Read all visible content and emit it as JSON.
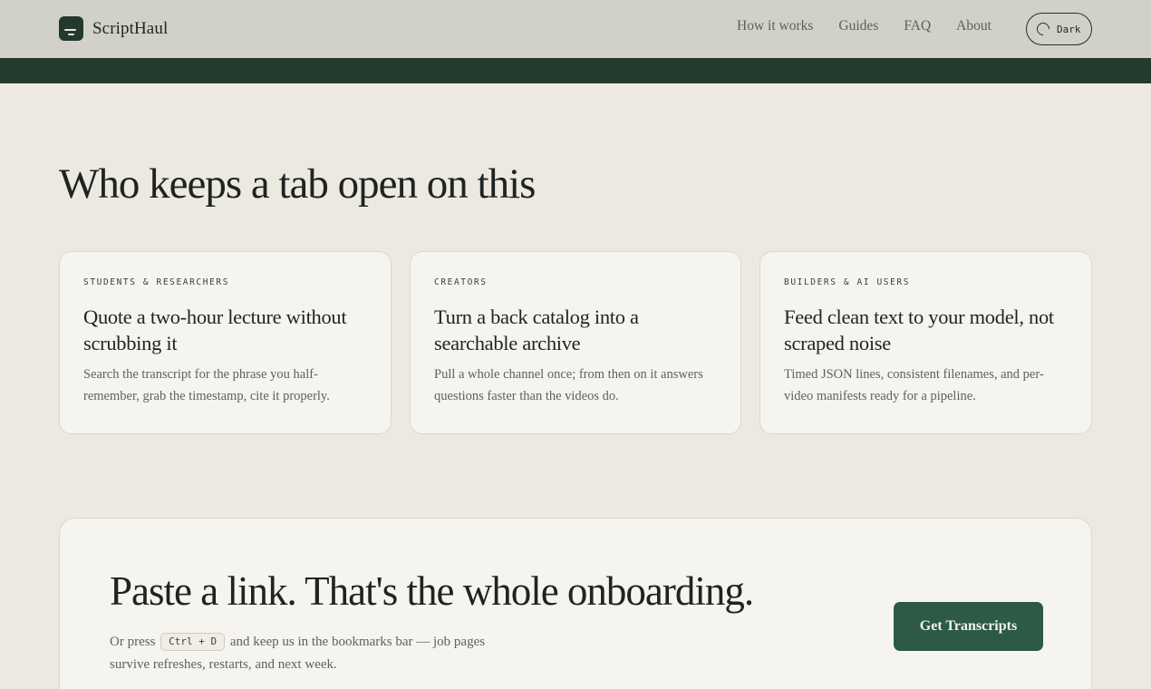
{
  "header": {
    "brand_name": "ScriptHaul",
    "nav": [
      "How it works",
      "Guides",
      "FAQ",
      "About"
    ],
    "theme_toggle_label": "Dark"
  },
  "section": {
    "title": "Who keeps a tab open on this",
    "cards": [
      {
        "eyebrow": "STUDENTS & RESEARCHERS",
        "title": "Quote a two-hour lecture without scrubbing it",
        "body": "Search the transcript for the phrase you half-remember, grab the timestamp, cite it properly."
      },
      {
        "eyebrow": "CREATORS",
        "title": "Turn a back catalog into a searchable archive",
        "body": "Pull a whole channel once; from then on it answers questions faster than the videos do."
      },
      {
        "eyebrow": "BUILDERS & AI USERS",
        "title": "Feed clean text to your model, not scraped noise",
        "body": "Timed JSON lines, consistent filenames, and per-video manifests ready for a pipeline."
      }
    ]
  },
  "cta": {
    "title": "Paste a link. That's the whole onboarding.",
    "text_before": "Or press",
    "shortcut": "Ctrl + D",
    "text_after": "and keep us in the bookmarks bar — job pages survive refreshes, restarts, and next week.",
    "button_label": "Get Transcripts"
  },
  "colors": {
    "accent": "#2c5a45",
    "band": "#233a2d",
    "header_bg": "#d1d1c9",
    "page_bg": "#ece9e1"
  }
}
